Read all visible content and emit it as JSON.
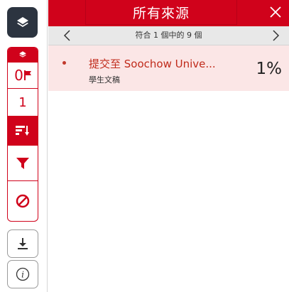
{
  "header": {
    "title": "所有來源"
  },
  "nav": {
    "counter": "符合 1 個中的 9 個"
  },
  "sidebar": {
    "flag_count": "0",
    "number": "1"
  },
  "source": {
    "name": "提交至 Soochow Unive...",
    "type": "學生文稿",
    "percent": "1%"
  },
  "colors": {
    "accent": "#d0021b",
    "dark": "#2c3440"
  },
  "icons": [
    "layers-icon",
    "flag-icon",
    "sort-icon",
    "filter-icon",
    "block-icon",
    "download-icon",
    "info-icon",
    "close-icon",
    "chevron-left-icon",
    "chevron-right-icon"
  ]
}
